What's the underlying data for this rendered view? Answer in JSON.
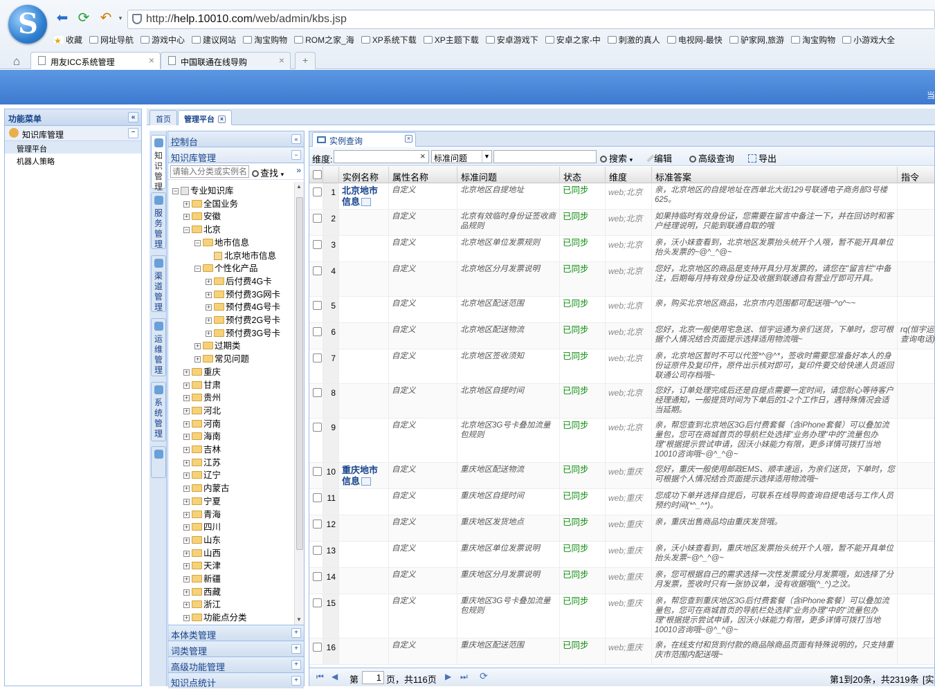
{
  "browser": {
    "url_prefix": "http://",
    "url_domain": "help.10010.com",
    "url_path": "/web/admin/kbs.jsp",
    "bookmarks": [
      "收藏",
      "网址导航",
      "游戏中心",
      "建议网站",
      "淘宝购物",
      "ROM之家_海",
      "XP系统下载",
      "XP主题下载",
      "安卓游戏下",
      "安卓之家-中",
      "刺激的真人",
      "电视网-最快",
      "驴家网,旅游",
      "淘宝购物",
      "小游戏大全"
    ],
    "tabs": [
      "用友ICC系统管理",
      "中国联通在线导购"
    ],
    "new_tab": "+"
  },
  "banner": {
    "right_text": "当"
  },
  "leftnav": {
    "title": "功能菜单",
    "section": "知识库管理",
    "items": [
      "管理平台",
      "机器人策略"
    ]
  },
  "main_tabs": [
    "首页",
    "管理平台"
  ],
  "vtabs": [
    {
      "label": "知识管理"
    },
    {
      "label": "服务管理"
    },
    {
      "label": "渠道管理"
    },
    {
      "label": "运维管理"
    },
    {
      "label": "系统管理"
    }
  ],
  "tree": {
    "header": "控制台",
    "section": "知识库管理",
    "search_placeholder": "请输入分类或实例名",
    "search_button": "查找",
    "more": "»",
    "nodes": [
      {
        "label": "专业知识库",
        "level": 0,
        "exp": "⊟",
        "type": "db"
      },
      {
        "label": "全国业务",
        "level": 1,
        "exp": "⊞",
        "type": "folder"
      },
      {
        "label": "安徽",
        "level": 1,
        "exp": "⊞",
        "type": "folder"
      },
      {
        "label": "北京",
        "level": 1,
        "exp": "⊟",
        "type": "folder"
      },
      {
        "label": "地市信息",
        "level": 2,
        "exp": "⊟",
        "type": "folder"
      },
      {
        "label": "北京地市信息",
        "level": 3,
        "exp": "",
        "type": "leaf"
      },
      {
        "label": "个性化产品",
        "level": 2,
        "exp": "⊟",
        "type": "folder"
      },
      {
        "label": "后付费4G卡",
        "level": 3,
        "exp": "⊞",
        "type": "folder"
      },
      {
        "label": "预付费3G网卡",
        "level": 3,
        "exp": "⊞",
        "type": "folder"
      },
      {
        "label": "预付费4G号卡",
        "level": 3,
        "exp": "⊞",
        "type": "folder"
      },
      {
        "label": "预付费2G号卡",
        "level": 3,
        "exp": "⊞",
        "type": "folder"
      },
      {
        "label": "预付费3G号卡",
        "level": 3,
        "exp": "⊞",
        "type": "folder"
      },
      {
        "label": "过期类",
        "level": 2,
        "exp": "⊞",
        "type": "folder"
      },
      {
        "label": "常见问题",
        "level": 2,
        "exp": "⊞",
        "type": "folder"
      },
      {
        "label": "重庆",
        "level": 1,
        "exp": "⊞",
        "type": "folder"
      },
      {
        "label": "甘肃",
        "level": 1,
        "exp": "⊞",
        "type": "folder"
      },
      {
        "label": "贵州",
        "level": 1,
        "exp": "⊞",
        "type": "folder"
      },
      {
        "label": "河北",
        "level": 1,
        "exp": "⊞",
        "type": "folder"
      },
      {
        "label": "河南",
        "level": 1,
        "exp": "⊞",
        "type": "folder"
      },
      {
        "label": "海南",
        "level": 1,
        "exp": "⊞",
        "type": "folder"
      },
      {
        "label": "吉林",
        "level": 1,
        "exp": "⊞",
        "type": "folder"
      },
      {
        "label": "江苏",
        "level": 1,
        "exp": "⊞",
        "type": "folder"
      },
      {
        "label": "辽宁",
        "level": 1,
        "exp": "⊞",
        "type": "folder"
      },
      {
        "label": "内蒙古",
        "level": 1,
        "exp": "⊞",
        "type": "folder"
      },
      {
        "label": "宁夏",
        "level": 1,
        "exp": "⊞",
        "type": "folder"
      },
      {
        "label": "青海",
        "level": 1,
        "exp": "⊞",
        "type": "folder"
      },
      {
        "label": "四川",
        "level": 1,
        "exp": "⊞",
        "type": "folder"
      },
      {
        "label": "山东",
        "level": 1,
        "exp": "⊞",
        "type": "folder"
      },
      {
        "label": "山西",
        "level": 1,
        "exp": "⊞",
        "type": "folder"
      },
      {
        "label": "天津",
        "level": 1,
        "exp": "⊞",
        "type": "folder"
      },
      {
        "label": "新疆",
        "level": 1,
        "exp": "⊞",
        "type": "folder"
      },
      {
        "label": "西藏",
        "level": 1,
        "exp": "⊞",
        "type": "folder"
      },
      {
        "label": "浙江",
        "level": 1,
        "exp": "⊞",
        "type": "folder"
      },
      {
        "label": "功能点分类",
        "level": 1,
        "exp": "⊞",
        "type": "folder"
      }
    ],
    "accordions": [
      "本体类管理",
      "词类管理",
      "高级功能管理",
      "知识点统计"
    ]
  },
  "grid": {
    "tab": "实例查询",
    "toolbar": {
      "dim_label": "维度:",
      "select_value": "标准问题",
      "search": "搜索",
      "edit": "编辑",
      "advanced": "高级查询",
      "export": "导出"
    },
    "headers": [
      "实例名称",
      "属性名称",
      "标准问题",
      "状态",
      "维度",
      "标准答案",
      "指令"
    ],
    "rows": [
      {
        "n": "1",
        "inst": "北京地市信息",
        "attr": "自定义",
        "q": "北京地区自提地址",
        "st": "已同步",
        "dim": "web;北京",
        "ans": "亲，北京地区的自提地址在西单北大街129号联通电子商务部3号楼625。",
        "cmd": ""
      },
      {
        "n": "2",
        "inst": "",
        "attr": "自定义",
        "q": "北京有效临时身份证签收商品规则",
        "st": "已同步",
        "dim": "web;北京",
        "ans": "如果持临时有效身份证，您需要在留言中备注一下，并在回访时和客户经理说明，只能到联通自取的哦",
        "cmd": ""
      },
      {
        "n": "3",
        "inst": "",
        "attr": "自定义",
        "q": "北京地区单位发票规则",
        "st": "已同步",
        "dim": "web;北京",
        "ans": "亲，沃小妹查看到，北京地区发票抬头统开个人哦，暂不能开具单位抬头发票的~@^_^@~",
        "cmd": ""
      },
      {
        "n": "4",
        "inst": "",
        "attr": "自定义",
        "q": "北京地区分月发票说明",
        "st": "已同步",
        "dim": "web;北京",
        "ans": "您好，北京地区的商品是支持开具分月发票的，请您在\"留言栏\"中备注，后期每月持有效身份证及收据到联通自有营业厅即可开具。",
        "cmd": ""
      },
      {
        "n": "5",
        "inst": "",
        "attr": "自定义",
        "q": "北京地区配送范围",
        "st": "已同步",
        "dim": "web;北京",
        "ans": "亲，购买北京地区商品，北京市内范围都可配送哦~^o^~~",
        "cmd": ""
      },
      {
        "n": "6",
        "inst": "",
        "attr": "自定义",
        "q": "北京地区配送物流",
        "st": "已同步",
        "dim": "web;北京",
        "ans": "您好，北京一般使用宅急送、恒宇运通为亲们送货，下单时，您可根据个人情况结合页面提示选择适用物流哦~",
        "cmd": "rq(恒宇运查询电话)"
      },
      {
        "n": "7",
        "inst": "",
        "attr": "自定义",
        "q": "北京地区签收须知",
        "st": "已同步",
        "dim": "web;北京",
        "ans": "亲，北京地区暂时不可以代签*^@^*，签收时需要您准备好本人的身份证原件及复印件，原件出示核对即可，复印件要交给快递人员返回联通公司存档哦~",
        "cmd": ""
      },
      {
        "n": "8",
        "inst": "",
        "attr": "自定义",
        "q": "北京地区自提时间",
        "st": "已同步",
        "dim": "web;北京",
        "ans": "您好，订单处理完成后还是自提点需要一定时间，请您耐心等待客户经理通知，一般提货时间为下单后的1-2个工作日，遇特殊情况会适当延期。",
        "cmd": ""
      },
      {
        "n": "9",
        "inst": "",
        "attr": "自定义",
        "q": "北京地区3G号卡叠加流量包规则",
        "st": "已同步",
        "dim": "web;北京",
        "ans": "亲，帮您查到北京地区3G后付费套餐（含iPhone套餐）可以叠加流量包，您可在商城首页的导航栏处选择\"业务办理\"中的\"流量包办理\"根据提示尝试申请，因沃小妹能力有限，更多详情可拨打当地10010咨询哦~@^_^@~",
        "cmd": ""
      },
      {
        "n": "10",
        "inst": "重庆地市信息",
        "attr": "自定义",
        "q": "重庆地区配送物流",
        "st": "已同步",
        "dim": "web;重庆",
        "ans": "您好，重庆一般使用邮政EMS、顺丰速运，为亲们送货，下单时，您可根据个人情况结合页面提示选择适用物流哦~",
        "cmd": ""
      },
      {
        "n": "11",
        "inst": "",
        "attr": "自定义",
        "q": "重庆地区自提时间",
        "st": "已同步",
        "dim": "web;重庆",
        "ans": "您成功下单并选择自提后，可联系在线导购查询自提电话与工作人员预约时间(*^_^*)。",
        "cmd": ""
      },
      {
        "n": "12",
        "inst": "",
        "attr": "自定义",
        "q": "重庆地区发货地点",
        "st": "已同步",
        "dim": "web;重庆",
        "ans": "亲，重庆出售商品均由重庆发货哦。",
        "cmd": ""
      },
      {
        "n": "13",
        "inst": "",
        "attr": "自定义",
        "q": "重庆地区单位发票说明",
        "st": "已同步",
        "dim": "web;重庆",
        "ans": "亲，沃小妹查看到，重庆地区发票抬头统开个人哦，暂不能开具单位抬头发票~@^_^@~",
        "cmd": ""
      },
      {
        "n": "14",
        "inst": "",
        "attr": "自定义",
        "q": "重庆地区分月发票说明",
        "st": "已同步",
        "dim": "web;重庆",
        "ans": "亲，您可根据自己的需求选择一次性发票或分月发票哦，如选择了分月发票，签收时只有一张协议单，没有收据哦(^_^)之汶。",
        "cmd": ""
      },
      {
        "n": "15",
        "inst": "",
        "attr": "自定义",
        "q": "重庆地区3G号卡叠加流量包规则",
        "st": "已同步",
        "dim": "web;重庆",
        "ans": "亲，帮您查到重庆地区3G后付费套餐（含iPhone套餐）可以叠加流量包，您可在商城首页的导航栏处选择\"业务办理\"中的\"流量包办理\"根据提示尝试申请，因沃小妹能力有限，更多详情可拨打当地10010咨询哦~@^_^@~",
        "cmd": ""
      },
      {
        "n": "16",
        "inst": "",
        "attr": "自定义",
        "q": "重庆地区配送范围",
        "st": "已同步",
        "dim": "web;重庆",
        "ans": "亲，在线支付和货到付款的商品除商品页面有特殊说明的，只支持重庆市范围内配送哦~",
        "cmd": ""
      }
    ],
    "pager": {
      "page_prefix": "第",
      "page_value": "1",
      "page_suffix": "页，共116页",
      "summary": "第1到20条，共2319条",
      "tail": "[实"
    }
  }
}
